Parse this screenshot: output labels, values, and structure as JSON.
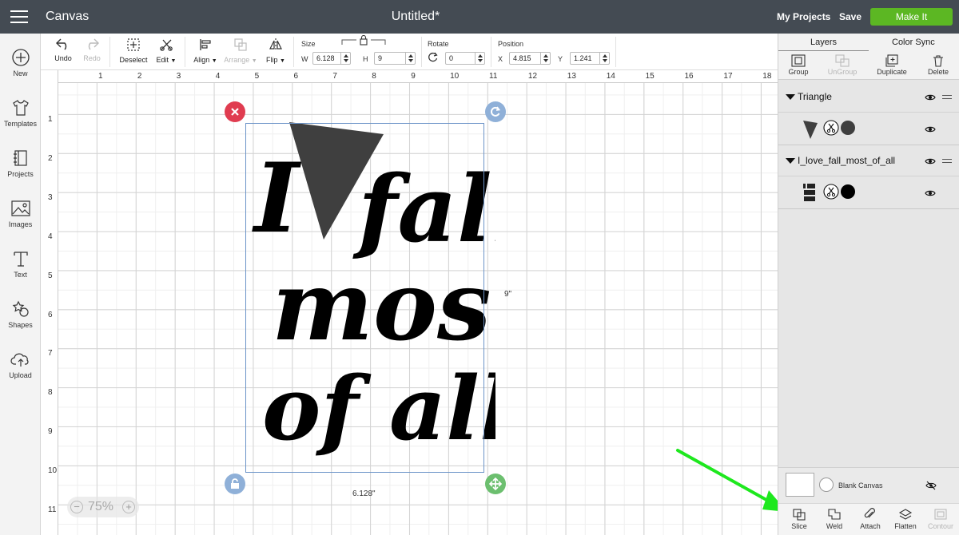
{
  "topbar": {
    "app_title": "Canvas",
    "doc_title": "Untitled*",
    "my_projects": "My Projects",
    "save": "Save",
    "make_it": "Make It",
    "make_it_color": "#5cb723"
  },
  "sidebar": {
    "items": [
      {
        "label": "New",
        "icon": "plus-circle-icon"
      },
      {
        "label": "Templates",
        "icon": "tshirt-icon"
      },
      {
        "label": "Projects",
        "icon": "notebook-icon"
      },
      {
        "label": "Images",
        "icon": "image-icon"
      },
      {
        "label": "Text",
        "icon": "text-t-icon"
      },
      {
        "label": "Shapes",
        "icon": "shapes-icon"
      },
      {
        "label": "Upload",
        "icon": "cloud-upload-icon"
      }
    ]
  },
  "toolbar": {
    "undo": "Undo",
    "redo": "Redo",
    "deselect": "Deselect",
    "edit": "Edit",
    "align": "Align",
    "arrange": "Arrange",
    "flip": "Flip",
    "size_label": "Size",
    "w_label": "W",
    "w_value": "6.128",
    "h_label": "H",
    "h_value": "9",
    "rotate_label": "Rotate",
    "rotate_value": "0",
    "position_label": "Position",
    "x_label": "X",
    "x_value": "4.815",
    "y_label": "Y",
    "y_value": "1.241"
  },
  "rulers": {
    "top": [
      "1",
      "2",
      "3",
      "4",
      "5",
      "6",
      "7",
      "8",
      "9",
      "10",
      "11",
      "12",
      "13",
      "14",
      "15",
      "16",
      "17",
      "18"
    ],
    "left": [
      "1",
      "2",
      "3",
      "4",
      "5",
      "6",
      "7",
      "8",
      "9",
      "10",
      "11"
    ]
  },
  "canvas": {
    "width_label": "6.128\"",
    "height_label": "9\"",
    "artwork_lines": [
      "I",
      "fall",
      "most",
      "of all"
    ],
    "zoom": "75%"
  },
  "panel": {
    "tabs": [
      "Layers",
      "Color Sync"
    ],
    "actions": [
      "Group",
      "UnGroup",
      "Duplicate",
      "Delete"
    ],
    "groups": [
      {
        "name": "Triangle",
        "fill": "#3f3f3f"
      },
      {
        "name": "I_love_fall_most_of_all",
        "fill": "#000000"
      }
    ],
    "blank_canvas": "Blank Canvas",
    "bottom_tools": [
      "Slice",
      "Weld",
      "Attach",
      "Flatten",
      "Contour"
    ]
  },
  "annotation": {
    "arrow_color": "#1ee81e"
  }
}
